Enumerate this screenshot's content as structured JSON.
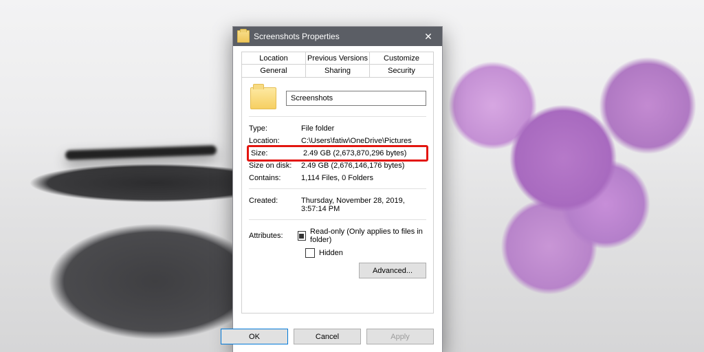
{
  "window": {
    "title": "Screenshots Properties"
  },
  "tabs": {
    "back": [
      "Location",
      "Previous Versions",
      "Customize"
    ],
    "front": [
      "General",
      "Sharing",
      "Security"
    ],
    "active": "General"
  },
  "general": {
    "name": "Screenshots",
    "type_label": "Type:",
    "type_value": "File folder",
    "location_label": "Location:",
    "location_value": "C:\\Users\\fatiw\\OneDrive\\Pictures",
    "size_label": "Size:",
    "size_value": "2.49 GB (2,673,870,296 bytes)",
    "size_on_disk_label": "Size on disk:",
    "size_on_disk_value": "2.49 GB (2,676,146,176 bytes)",
    "contains_label": "Contains:",
    "contains_value": "1,114 Files, 0 Folders",
    "created_label": "Created:",
    "created_value": "Thursday, November 28, 2019, 3:57:14 PM",
    "attributes_label": "Attributes:",
    "readonly_label": "Read-only (Only applies to files in folder)",
    "hidden_label": "Hidden",
    "advanced_label": "Advanced..."
  },
  "buttons": {
    "ok": "OK",
    "cancel": "Cancel",
    "apply": "Apply"
  }
}
